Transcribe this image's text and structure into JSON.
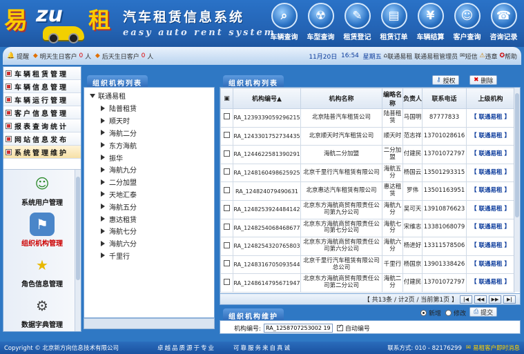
{
  "header": {
    "logo": {
      "part1": "易",
      "part2": "zu",
      "part3": "租"
    },
    "title": "汽车租赁信息系统",
    "subtitle": "easy auto rent system",
    "nav": [
      {
        "label": "车辆查询",
        "icon": "magnifier-icon"
      },
      {
        "label": "车型查询",
        "icon": "hazard-icon"
      },
      {
        "label": "租赁登记",
        "icon": "pencil-icon"
      },
      {
        "label": "租赁订单",
        "icon": "document-icon"
      },
      {
        "label": "车辆结算",
        "icon": "money-icon"
      },
      {
        "label": "客户查询",
        "icon": "users-icon"
      },
      {
        "label": "咨询记录",
        "icon": "phone-icon"
      }
    ]
  },
  "status": {
    "remind_label": "提醒",
    "tomorrow_label": "明天生日客户",
    "tomorrow_count": "0",
    "after_label": "后天生日客户",
    "after_count": "0",
    "unit": "人",
    "date": "11月20日",
    "time": "16:54",
    "weekday": "星期五",
    "company": "联通易租",
    "user": "联通易租管理员",
    "msg": "短信",
    "violation": "违章",
    "help": "帮助"
  },
  "leftnav": {
    "menus": [
      "车辆租赁管理",
      "车辆信息管理",
      "车辆运行管理",
      "客户信息管理",
      "报表查询统计",
      "网站信息发布",
      "系统管理维护"
    ],
    "subitems": [
      {
        "label": "系统用户管理",
        "icon": "users-icon"
      },
      {
        "label": "组织机构管理",
        "icon": "organization-icon"
      },
      {
        "label": "角色信息管理",
        "icon": "star-icon"
      },
      {
        "label": "数据字典管理",
        "icon": "gears-icon"
      }
    ]
  },
  "tree": {
    "tab": "组织机构列表",
    "root": "联通易租",
    "nodes": [
      "陆普租赁",
      "顺天时",
      "海航二分",
      "东方海航",
      "振华",
      "海航九分",
      "二分加盟",
      "天地汇泰",
      "海航五分",
      "惠达租赁",
      "海航七分",
      "海航六分",
      "千里行"
    ]
  },
  "grid": {
    "tab": "组织机构列表",
    "auth_btn": "授权",
    "del_btn": "删除",
    "headers": {
      "code": "机构编号▲",
      "name": "机构名称",
      "short": "编略名称",
      "person": "负责人",
      "phone": "联系电话",
      "parent": "上级机构"
    },
    "action_label": "【 联通易租 】",
    "rows": [
      {
        "code": "RA_1239339059296215",
        "name": "北京陆普汽车租赁公司",
        "short": "陆普租赁",
        "person": "马国明",
        "phone": "87777833"
      },
      {
        "code": "RA_1243301752734435",
        "name": "北京顺天时汽车租赁公司",
        "short": "顺天时",
        "person": "范志祥",
        "phone": "13701028616"
      },
      {
        "code": "RA_1244622581390291",
        "name": "海航二分加盟",
        "short": "二分加盟",
        "person": "付建民",
        "phone": "13701072797"
      },
      {
        "code": "RA_1248160498625925",
        "name": "北京千里行汽车租赁有限公司",
        "short": "海航五分",
        "person": "杨国云",
        "phone": "13501293315"
      },
      {
        "code": "RA_124824079490631",
        "name": "北京惠达汽车租赁有限公司",
        "short": "惠达租赁",
        "person": "罗伟",
        "phone": "13501163951"
      },
      {
        "code": "RA_1248253924484142",
        "name": "北京东方海航商贸有限责任公司第九分公司",
        "short": "海航九分",
        "person": "吴可天",
        "phone": "13910876623"
      },
      {
        "code": "RA_1248254068468677",
        "name": "北京东方海航商贸有限责任公司第七分公司",
        "short": "海航七分",
        "person": "宋维志",
        "phone": "13381068079"
      },
      {
        "code": "RA_1248254320765803",
        "name": "北京东方海航商贸有限责任公司第六分公司",
        "short": "海航六分",
        "person": "杨进好",
        "phone": "13311578506"
      },
      {
        "code": "RA_1248316705093544",
        "name": "北京千里行汽车租赁有限公司总公司",
        "short": "千里行",
        "person": "杨国京",
        "phone": "13901338426"
      },
      {
        "code": "RA_1248614795671947",
        "name": "北京东方海航商贸有限责任公司第二分公司",
        "short": "海航二分",
        "person": "付建民",
        "phone": "13701072797"
      }
    ],
    "pager": "【 共13条 / 计2页 / 当前第1页 】"
  },
  "maint": {
    "tab": "组织机构维护",
    "opt_new": "新增",
    "opt_edit": "修改",
    "submit": "提交",
    "code_label": "机构编号:",
    "code_value": "RA_1258707253002 19",
    "auto_label": "自动编号"
  },
  "footer": {
    "copyright": "Copyright © 北京新方向信息技术有限公司",
    "slogan1": "卓越品质源于专业",
    "slogan2": "可靠服务来自真诚",
    "contact": "联系方式: 010 - 82176299",
    "msg": "易租客户即时消息"
  }
}
